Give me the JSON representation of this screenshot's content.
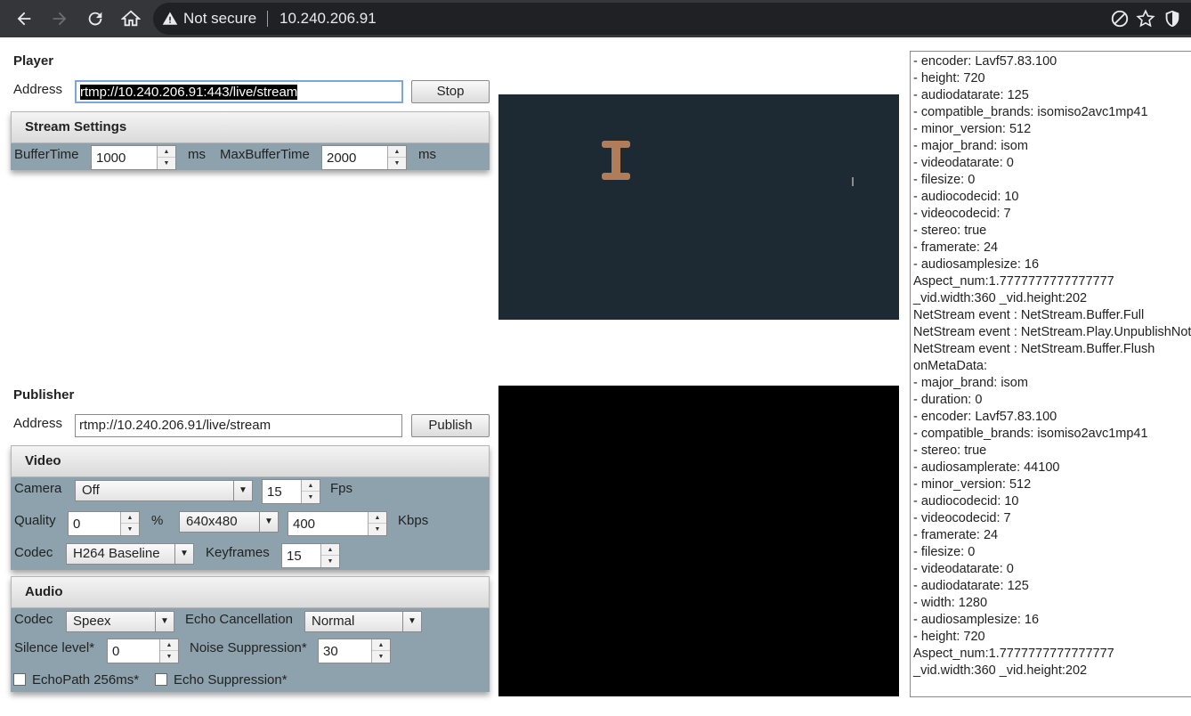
{
  "browser": {
    "security_label": "Not secure",
    "url": "10.240.206.91"
  },
  "player": {
    "title": "Player",
    "address_label": "Address",
    "address_value": "rtmp://10.240.206.91:443/live/stream",
    "stop_label": "Stop",
    "settings_title": "Stream Settings",
    "buffer_time_label": "BufferTime",
    "buffer_time_value": "1000",
    "buffer_unit": "ms",
    "max_buffer_label": "MaxBufferTime",
    "max_buffer_value": "2000",
    "max_buffer_unit": "ms"
  },
  "publisher": {
    "title": "Publisher",
    "address_label": "Address",
    "address_value": "rtmp://10.240.206.91/live/stream",
    "publish_label": "Publish",
    "video": {
      "title": "Video",
      "camera_label": "Camera",
      "camera_value": "Off",
      "fps_value": "15",
      "fps_label": "Fps",
      "quality_label": "Quality",
      "quality_value": "0",
      "quality_unit": "%",
      "resolution_value": "640x480",
      "bitrate_value": "400",
      "bitrate_unit": "Kbps",
      "codec_label": "Codec",
      "codec_value": "H264 Baseline",
      "keyframes_label": "Keyframes",
      "keyframes_value": "15"
    },
    "audio": {
      "title": "Audio",
      "codec_label": "Codec",
      "codec_value": "Speex",
      "echo_label": "Echo Cancellation",
      "echo_value": "Normal",
      "silence_label": "Silence level*",
      "silence_value": "0",
      "noise_label": "Noise Suppression*",
      "noise_value": "30",
      "echopath_label": "EchoPath 256ms*",
      "echosup_label": "Echo Suppression*"
    }
  },
  "log_lines": [
    " - encoder: Lavf57.83.100",
    " - height: 720",
    " - audiodatarate: 125",
    " - compatible_brands: isomiso2avc1mp41",
    " - minor_version: 512",
    " - major_brand: isom",
    " - videodatarate: 0",
    " - filesize: 0",
    " - audiocodecid: 10",
    " - videocodecid: 7",
    " - stereo: true",
    " - framerate: 24",
    " - audiosamplesize: 16",
    "Aspect_num:1.7777777777777777",
    "_vid.width:360  _vid.height:202",
    "NetStream event : NetStream.Buffer.Full",
    "NetStream event : NetStream.Play.UnpublishNotify",
    "NetStream event : NetStream.Buffer.Flush",
    "onMetaData:",
    " - major_brand: isom",
    " - duration: 0",
    " - encoder: Lavf57.83.100",
    " - compatible_brands: isomiso2avc1mp41",
    " - stereo: true",
    " - audiosamplerate: 44100",
    " - minor_version: 512",
    " - audiocodecid: 10",
    " - videocodecid: 7",
    " - framerate: 24",
    " - filesize: 0",
    " - videodatarate: 0",
    " - audiodatarate: 125",
    " - width: 1280",
    " - audiosamplesize: 16",
    " - height: 720",
    "Aspect_num:1.7777777777777777",
    "_vid.width:360  _vid.height:202"
  ]
}
